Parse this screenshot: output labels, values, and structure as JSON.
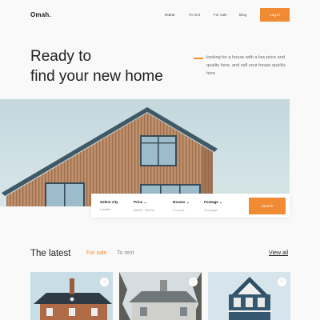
{
  "header": {
    "logo": "Omah.",
    "nav": [
      {
        "label": "Home",
        "active": true
      },
      {
        "label": "To rent",
        "active": false
      },
      {
        "label": "For sale",
        "active": false
      },
      {
        "label": "Blog",
        "active": false
      }
    ],
    "login_label": "Log in"
  },
  "hero": {
    "title_line1": "Ready to",
    "title_line2": "find your new home",
    "description": "looking for a house with a low price and quality here, and sell your house quickly here"
  },
  "search": {
    "fields": [
      {
        "label": "Select city",
        "value": "Lobatis"
      },
      {
        "label": "Price",
        "value": "$5000 - $2000"
      },
      {
        "label": "Rooms",
        "value": "3 rooms"
      },
      {
        "label": "Footage",
        "value": "3 footage"
      }
    ],
    "button_label": "Search"
  },
  "latest": {
    "title": "The latest",
    "tabs": [
      {
        "label": "For sale",
        "active": true
      },
      {
        "label": "To rent",
        "active": false
      }
    ],
    "view_all_label": "View all"
  },
  "colors": {
    "accent": "#f08a33",
    "background": "#f9f9f9",
    "text": "#1e1e1e"
  },
  "icons": {
    "field_chevron": "chevron-down-icon",
    "favorite": "heart-icon"
  }
}
